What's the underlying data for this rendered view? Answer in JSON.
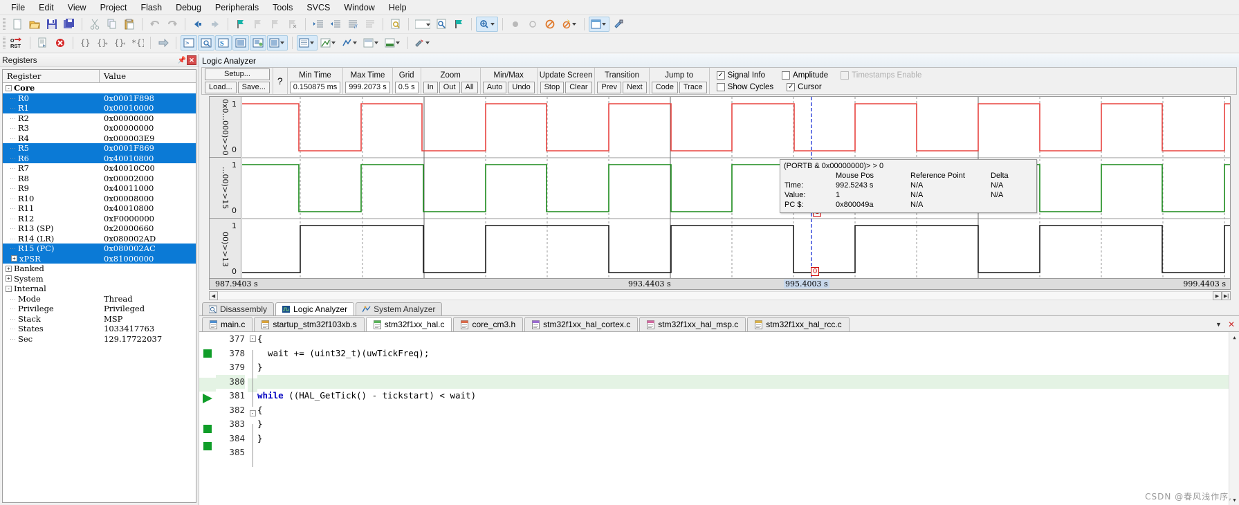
{
  "menu": {
    "items": [
      "File",
      "Edit",
      "View",
      "Project",
      "Flash",
      "Debug",
      "Peripherals",
      "Tools",
      "SVCS",
      "Window",
      "Help"
    ]
  },
  "toolbar1": {
    "buttons": [
      {
        "name": "new-file",
        "label": "New"
      },
      {
        "name": "open-file",
        "label": "Open"
      },
      {
        "name": "save-file",
        "label": "Save"
      },
      {
        "name": "save-all",
        "label": "Save All"
      },
      {
        "name": "cut",
        "label": "Cut"
      },
      {
        "name": "copy",
        "label": "Copy"
      },
      {
        "name": "paste",
        "label": "Paste"
      },
      {
        "name": "undo",
        "label": "Undo"
      },
      {
        "name": "redo",
        "label": "Redo"
      },
      {
        "name": "navigate-back",
        "label": "Back"
      },
      {
        "name": "navigate-forward",
        "label": "Forward"
      },
      {
        "name": "bookmark-toggle",
        "label": "Toggle Bookmark"
      },
      {
        "name": "bookmark-prev",
        "label": "Previous Bookmark"
      },
      {
        "name": "bookmark-next",
        "label": "Next Bookmark"
      },
      {
        "name": "bookmark-clear",
        "label": "Clear Bookmarks"
      },
      {
        "name": "indent",
        "label": "Indent"
      },
      {
        "name": "outdent",
        "label": "Outdent"
      },
      {
        "name": "comment",
        "label": "Comment"
      },
      {
        "name": "uncomment",
        "label": "Uncomment"
      },
      {
        "name": "find-in-files",
        "label": "Find in Files"
      },
      {
        "name": "find-combo",
        "label": "Find"
      },
      {
        "name": "find-go",
        "label": "Find Go"
      },
      {
        "name": "bookmark-flag",
        "label": "Flag"
      },
      {
        "name": "zoom-tool",
        "label": "Zoom"
      },
      {
        "name": "record-a",
        "label": "Record"
      },
      {
        "name": "record-b",
        "label": "Stop"
      },
      {
        "name": "disable-all",
        "label": "Disable"
      },
      {
        "name": "config-wizard",
        "label": "Configuration Wizard"
      },
      {
        "name": "window-layout",
        "label": "Window Layout"
      },
      {
        "name": "settings",
        "label": "Settings"
      }
    ]
  },
  "toolbar2": {
    "buttons": [
      {
        "name": "reset-cpu",
        "label": "Reset CPU"
      },
      {
        "name": "run-to-main",
        "label": "Run"
      },
      {
        "name": "stop-debug",
        "label": "Stop"
      },
      {
        "name": "step",
        "label": "Step"
      },
      {
        "name": "step-over",
        "label": "Step Over"
      },
      {
        "name": "step-out",
        "label": "Step Out"
      },
      {
        "name": "run-to-cursor",
        "label": "Run to Cursor"
      },
      {
        "name": "show-next-statement",
        "label": "Show Next Statement"
      },
      {
        "name": "command-window",
        "label": "Command Window"
      },
      {
        "name": "disassembly-window",
        "label": "Disassembly Window"
      },
      {
        "name": "symbols-window",
        "label": "Symbols Window"
      },
      {
        "name": "registers-window",
        "label": "Registers Window"
      },
      {
        "name": "call-stack-window",
        "label": "Call Stack Window"
      },
      {
        "name": "watch-window",
        "label": "Watch Window"
      },
      {
        "name": "memory-window",
        "label": "Memory Window"
      },
      {
        "name": "serial-window",
        "label": "Serial Window"
      },
      {
        "name": "analysis-window",
        "label": "Analysis Windows"
      },
      {
        "name": "trace-window",
        "label": "Trace Windows"
      },
      {
        "name": "system-viewer",
        "label": "System Viewer"
      },
      {
        "name": "toolbox",
        "label": "Toolbox"
      }
    ]
  },
  "registers": {
    "title": "Registers",
    "columns": [
      "Register",
      "Value"
    ],
    "rows": [
      {
        "name": "Core",
        "value": "",
        "level": 0,
        "toggle": "-",
        "bold": true,
        "selected": false
      },
      {
        "name": "R0",
        "value": "0x0001F898",
        "level": 1,
        "selected": true
      },
      {
        "name": "R1",
        "value": "0x00010000",
        "level": 1,
        "selected": true
      },
      {
        "name": "R2",
        "value": "0x00000000",
        "level": 1,
        "selected": false
      },
      {
        "name": "R3",
        "value": "0x00000000",
        "level": 1,
        "selected": false
      },
      {
        "name": "R4",
        "value": "0x000003E9",
        "level": 1,
        "selected": false
      },
      {
        "name": "R5",
        "value": "0x0001F869",
        "level": 1,
        "selected": true
      },
      {
        "name": "R6",
        "value": "0x40010800",
        "level": 1,
        "selected": true
      },
      {
        "name": "R7",
        "value": "0x40010C00",
        "level": 1,
        "selected": false
      },
      {
        "name": "R8",
        "value": "0x00002000",
        "level": 1,
        "selected": false
      },
      {
        "name": "R9",
        "value": "0x40011000",
        "level": 1,
        "selected": false
      },
      {
        "name": "R10",
        "value": "0x00008000",
        "level": 1,
        "selected": false
      },
      {
        "name": "R11",
        "value": "0x40010800",
        "level": 1,
        "selected": false
      },
      {
        "name": "R12",
        "value": "0xF0000000",
        "level": 1,
        "selected": false
      },
      {
        "name": "R13 (SP)",
        "value": "0x20000660",
        "level": 1,
        "selected": false
      },
      {
        "name": "R14 (LR)",
        "value": "0x080002AD",
        "level": 1,
        "selected": false
      },
      {
        "name": "R15 (PC)",
        "value": "0x080002AC",
        "level": 1,
        "selected": true
      },
      {
        "name": "xPSR",
        "value": "0x81000000",
        "level": 1,
        "toggle": "+",
        "selected": true
      },
      {
        "name": "Banked",
        "value": "",
        "level": 0,
        "toggle": "+",
        "selected": false
      },
      {
        "name": "System",
        "value": "",
        "level": 0,
        "toggle": "+",
        "selected": false
      },
      {
        "name": "Internal",
        "value": "",
        "level": 0,
        "toggle": "-",
        "selected": false
      },
      {
        "name": "Mode",
        "value": "Thread",
        "level": 1,
        "selected": false
      },
      {
        "name": "Privilege",
        "value": "Privileged",
        "level": 1,
        "selected": false
      },
      {
        "name": "Stack",
        "value": "MSP",
        "level": 1,
        "selected": false
      },
      {
        "name": "States",
        "value": "1033417763",
        "level": 1,
        "selected": false
      },
      {
        "name": "Sec",
        "value": "129.17722037",
        "level": 1,
        "selected": false
      }
    ]
  },
  "logic_analyzer": {
    "title": "Logic Analyzer",
    "setup_button": "Setup...",
    "load_button": "Load...",
    "save_button": "Save...",
    "help_button": "?",
    "min_time_label": "Min Time",
    "min_time_value": "0.150875 ms",
    "max_time_label": "Max Time",
    "max_time_value": "999.2073 s",
    "grid_label": "Grid",
    "grid_value": "0.5 s",
    "zoom_label": "Zoom",
    "zoom_in": "In",
    "zoom_out": "Out",
    "zoom_all": "All",
    "minmax_label": "Min/Max",
    "minmax_auto": "Auto",
    "minmax_undo": "Undo",
    "update_screen_label": "Update Screen",
    "update_stop": "Stop",
    "update_clear": "Clear",
    "transition_label": "Transition",
    "transition_prev": "Prev",
    "transition_next": "Next",
    "jumpto_label": "Jump to",
    "jumpto_code": "Code",
    "jumpto_trace": "Trace",
    "checkboxes": [
      {
        "label": "Signal Info",
        "checked": true,
        "disabled": false
      },
      {
        "label": "Amplitude",
        "checked": false,
        "disabled": false
      },
      {
        "label": "Timestamps Enable",
        "checked": false,
        "disabled": true
      },
      {
        "label": "Show Cycles",
        "checked": false,
        "disabled": false
      },
      {
        "label": "Cursor",
        "checked": true,
        "disabled": false
      }
    ],
    "signals": [
      {
        "label": "0x0...000)>>0",
        "color": "#e8433f",
        "max": "1",
        "min": "0"
      },
      {
        "label": "...00)>>15",
        "color": "#1a8a1a",
        "max": "1",
        "min": "0"
      },
      {
        "label": "00)>>13",
        "color": "#1a1a1a",
        "max": "1",
        "min": "0"
      }
    ],
    "time_axis": [
      "987.9403 s",
      "993.4403 s",
      "995.4003 s",
      "999.4403 s"
    ],
    "cursor_markers": [
      "1",
      "0"
    ],
    "tooltip": {
      "expression": "(PORTB & 0x00000000)> > 0",
      "col_mouse": "Mouse Pos",
      "col_reference": "Reference Point",
      "col_delta": "Delta",
      "rows": [
        {
          "label": "Time:",
          "mouse": "992.5243 s",
          "reference": "N/A",
          "delta": "N/A"
        },
        {
          "label": "Value:",
          "mouse": "1",
          "reference": "N/A",
          "delta": "N/A"
        },
        {
          "label": "PC $:",
          "mouse": "0x800049a",
          "reference": "N/A",
          "delta": ""
        }
      ]
    }
  },
  "view_tabs": [
    {
      "label": "Disassembly",
      "icon": "disassembly-icon",
      "active": false
    },
    {
      "label": "Logic Analyzer",
      "icon": "analyzer-icon",
      "active": true
    },
    {
      "label": "System Analyzer",
      "icon": "system-analyzer-icon",
      "active": false
    }
  ],
  "file_tabs": [
    {
      "label": "main.c",
      "active": false
    },
    {
      "label": "startup_stm32f103xb.s",
      "active": false
    },
    {
      "label": "stm32f1xx_hal.c",
      "active": true
    },
    {
      "label": "core_cm3.h",
      "active": false
    },
    {
      "label": "stm32f1xx_hal_cortex.c",
      "active": false
    },
    {
      "label": "stm32f1xx_hal_msp.c",
      "active": false
    },
    {
      "label": "stm32f1xx_hal_rcc.c",
      "active": false
    }
  ],
  "editor": {
    "lines": [
      {
        "num": "377",
        "text": "{",
        "fold": "-",
        "bp": false,
        "pc": false,
        "hl": false
      },
      {
        "num": "378",
        "text": "  wait += (uint32_t)(uwTickFreq);",
        "fold": "",
        "bp": true,
        "pc": false,
        "hl": false
      },
      {
        "num": "379",
        "text": "}",
        "fold": "",
        "bp": false,
        "pc": false,
        "hl": false
      },
      {
        "num": "380",
        "text": "",
        "fold": "",
        "bp": false,
        "pc": false,
        "hl": true
      },
      {
        "num": "381",
        "text": "while ((HAL_GetTick() - tickstart) < wait)",
        "fold": "",
        "bp": false,
        "pc": true,
        "hl": false,
        "kw": "while"
      },
      {
        "num": "382",
        "text": "{",
        "fold": "-",
        "bp": false,
        "pc": false,
        "hl": false
      },
      {
        "num": "383",
        "text": "}",
        "fold": "",
        "bp": true,
        "pc": false,
        "hl": false
      },
      {
        "num": "384",
        "text": "}",
        "fold": "",
        "bp": true,
        "pc": false,
        "hl": false
      },
      {
        "num": "385",
        "text": "",
        "fold": "",
        "bp": false,
        "pc": false,
        "hl": false
      }
    ]
  },
  "watermark": {
    "text": "CSDN @春风浅作序,"
  }
}
